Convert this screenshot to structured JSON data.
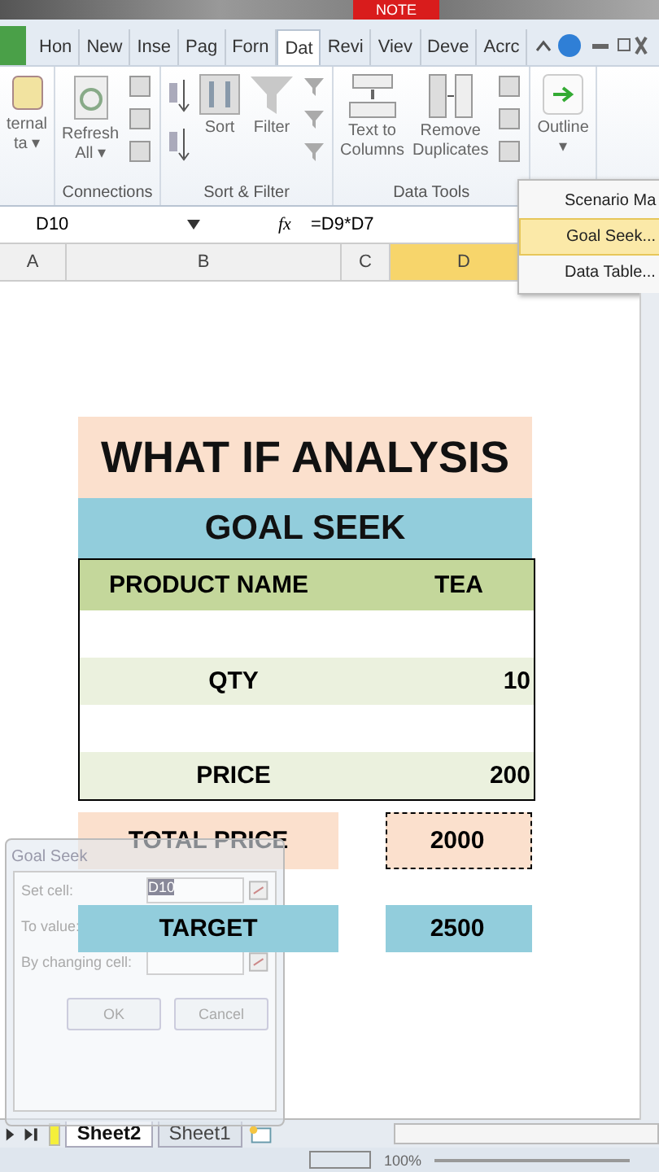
{
  "title_bar": {
    "badge": "NOTE"
  },
  "ribbon_tabs": [
    {
      "label": "Hon",
      "selected": false
    },
    {
      "label": "New",
      "selected": false
    },
    {
      "label": "Inse",
      "selected": false
    },
    {
      "label": "Pag",
      "selected": false
    },
    {
      "label": "Forn",
      "selected": false
    },
    {
      "label": "Dat",
      "selected": true
    },
    {
      "label": "Revi",
      "selected": false
    },
    {
      "label": "Viev",
      "selected": false
    },
    {
      "label": "Deve",
      "selected": false
    },
    {
      "label": "Acrc",
      "selected": false
    }
  ],
  "ribbon_groups": [
    {
      "buttons": [
        {
          "kind": "db",
          "label": "ternal\nta ▾"
        }
      ]
    },
    {
      "label": "Connections",
      "buttons": [
        {
          "kind": "refresh",
          "label": "Refresh\nAll ▾"
        },
        {
          "kind": "smallstack"
        }
      ]
    },
    {
      "label": "Sort & Filter",
      "buttons": [
        {
          "kind": "sortaz"
        },
        {
          "kind": "sort",
          "label": "Sort"
        },
        {
          "kind": "filter",
          "label": "Filter"
        },
        {
          "kind": "filtersmall"
        }
      ]
    },
    {
      "label": "Data Tools",
      "buttons": [
        {
          "kind": "textcol",
          "label": "Text to\nColumns"
        },
        {
          "kind": "dupes",
          "label": "Remove\nDuplicates"
        },
        {
          "kind": "smallstack"
        }
      ]
    },
    {
      "buttons": [
        {
          "kind": "outline",
          "label": "Outline\n▾"
        }
      ]
    }
  ],
  "data_menu": [
    {
      "label": "Scenario Ma",
      "selected": false
    },
    {
      "label": "Goal Seek...",
      "selected": true
    },
    {
      "label": "Data Table...",
      "selected": false
    }
  ],
  "formula_bar": {
    "name_box": "D10",
    "fx": "fx",
    "formula": "=D9*D7"
  },
  "columns": [
    {
      "label": "A",
      "selected": false
    },
    {
      "label": "B",
      "selected": false
    },
    {
      "label": "C",
      "selected": false
    },
    {
      "label": "D",
      "selected": true
    }
  ],
  "rows": [
    {
      "kind": "title",
      "b": "WHAT IF ANALYSIS",
      "d": "",
      "color": "#fbe0cd"
    },
    {
      "kind": "title2",
      "b": "GOAL SEEK",
      "d": "",
      "color": "#92cddc"
    },
    {
      "kind": "data",
      "b": "PRODUCT NAME",
      "d": "TEA",
      "color": "#c4d79b"
    },
    {
      "kind": "blank"
    },
    {
      "kind": "data",
      "b": "QTY",
      "d": "10",
      "color": "#ebf1de"
    },
    {
      "kind": "blank"
    },
    {
      "kind": "data",
      "b": "PRICE",
      "d": "200",
      "color": "#ebf1de"
    },
    {
      "kind": "total",
      "b": "TOTAL PRICE",
      "d": "2000",
      "color": "#fbe0cd"
    },
    {
      "kind": "target",
      "b": "TARGET",
      "d": "2500",
      "color": "#92cddc"
    }
  ],
  "goal_seek_dialog": {
    "title": "Goal Seek",
    "fields": [
      {
        "kind": "input",
        "label": "Set cell:",
        "value": "D10"
      },
      {
        "kind": "covered",
        "label": "To value:"
      },
      {
        "kind": "input",
        "label": "By changing cell:"
      }
    ],
    "buttons": [
      "OK",
      "Cancel"
    ]
  },
  "sheet_tabs": [
    {
      "label": "Sheet2",
      "selected": true
    },
    {
      "label": "Sheet1",
      "selected": false
    }
  ],
  "status_bar": {
    "zoom": "100%"
  }
}
